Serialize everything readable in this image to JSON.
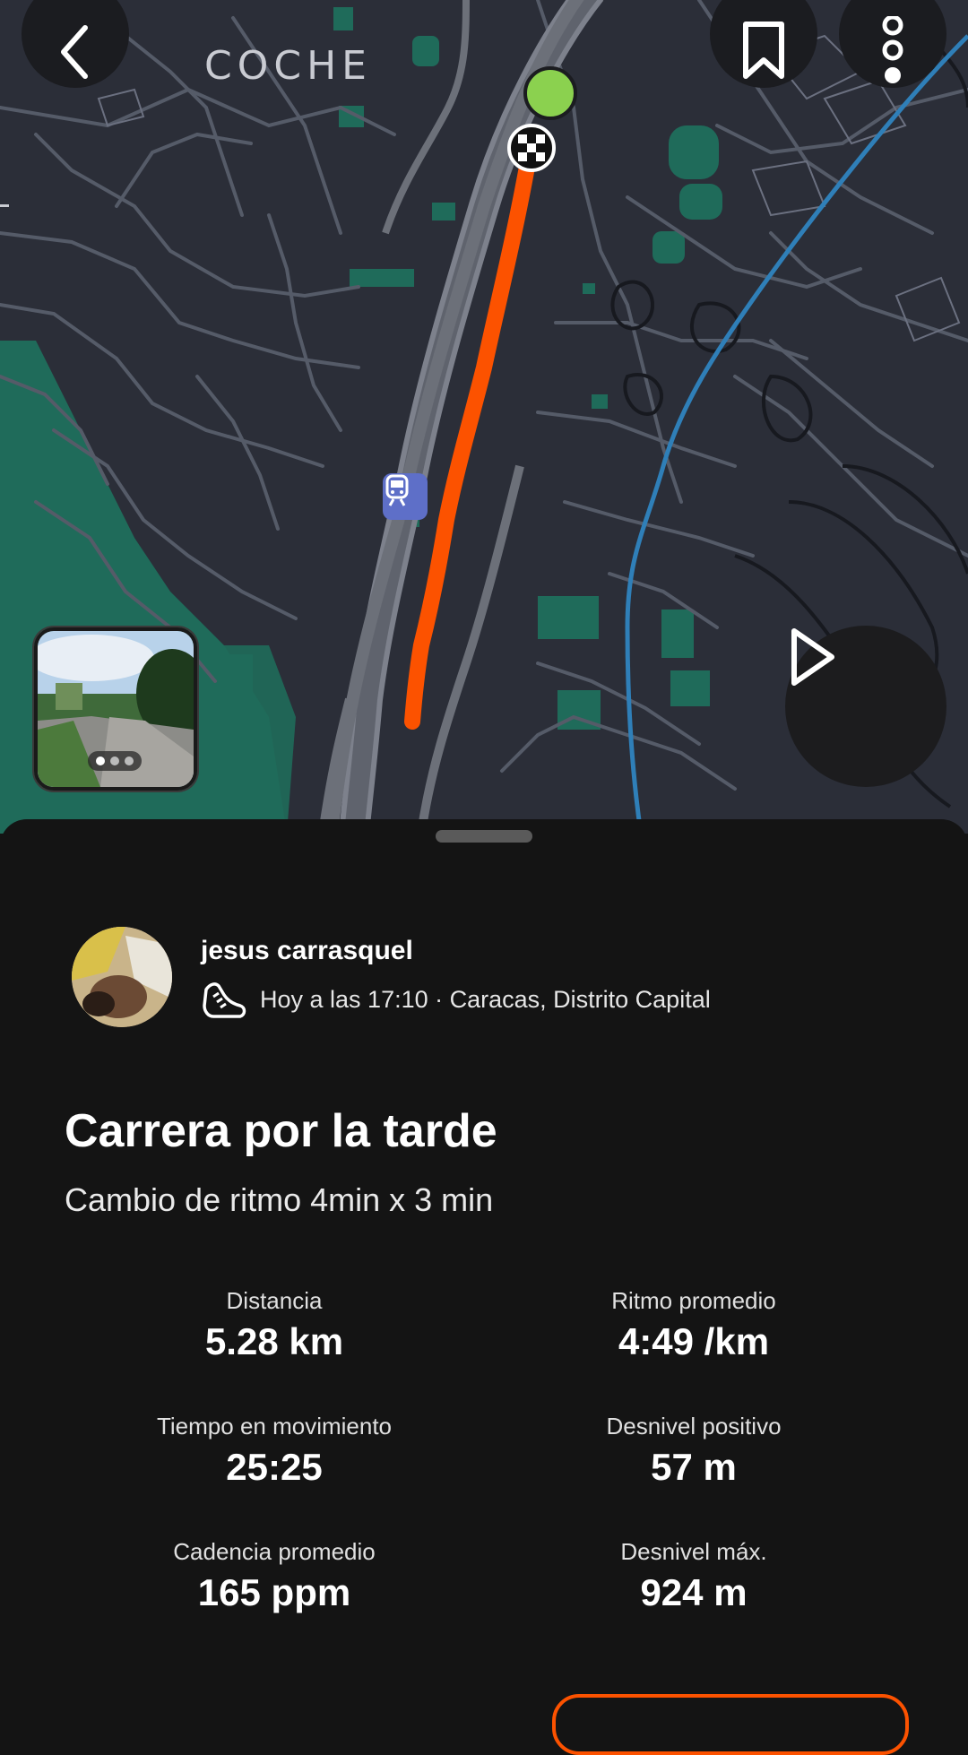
{
  "map": {
    "area_label": "COCHE",
    "route_color": "#fc5200",
    "start_marker_color": "#8bd14f",
    "park_color": "#1f6b5a"
  },
  "header": {
    "back_icon": "chevron-left-icon",
    "bookmark_icon": "bookmark-icon",
    "more_icon": "more-vertical-icon"
  },
  "media": {
    "photo_count": 3,
    "active_index": 0
  },
  "activity": {
    "user_name": "jesus carrasquel",
    "sport_icon": "running-shoe-icon",
    "meta": "Hoy a las 17:10 · Caracas, Distrito Capital",
    "title": "Carrera por la tarde",
    "description": "Cambio de ritmo 4min x 3 min"
  },
  "stats": [
    {
      "label": "Distancia",
      "value": "5.28 km"
    },
    {
      "label": "Ritmo promedio",
      "value": "4:49 /km"
    },
    {
      "label": "Tiempo en movimiento",
      "value": "25:25"
    },
    {
      "label": "Desnivel positivo",
      "value": "57 m"
    },
    {
      "label": "Cadencia promedio",
      "value": "165 ppm"
    },
    {
      "label": "Desnivel máx.",
      "value": "924 m"
    }
  ]
}
